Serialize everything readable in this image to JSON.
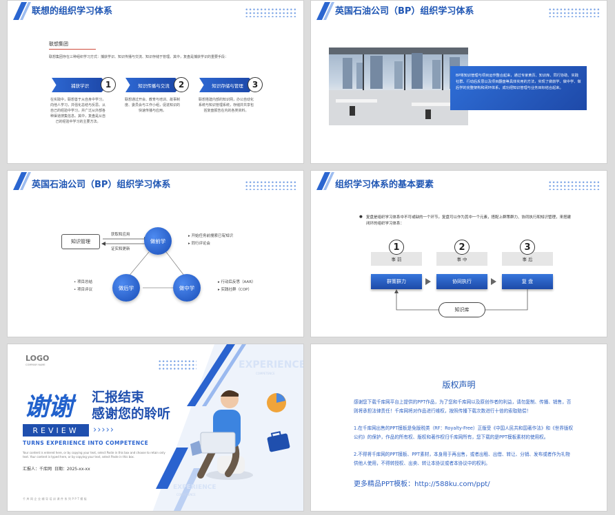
{
  "slide1": {
    "title": "联想的组织学习体系",
    "company": "联想集团",
    "intro": "联想集团存在三种组织学习方式：捕获学识、知识传播与交流、知识存储于管理。其中，复盘是捕获学识的重要手段：",
    "steps": [
      {
        "num": "1",
        "label": "捕获学识",
        "desc": "在实践中，联想善于从自身中学习，向他人学习，并强化总结与反思。从自己的经验中学习，并广泛从外部各种渠道搜集信息。其中，复盘是从自己的经验中学习的主要方法。"
      },
      {
        "num": "2",
        "label": "知识传播与交流",
        "desc": "联想通过开会、教育与培训、故事制度、委员会与工作小组，促进知识的快速传播与应用。"
      },
      {
        "num": "3",
        "label": "知识存储与管理",
        "desc": "联想搭建内部的知识网，办公自动化系统与知识管理系统，存储并共享包括复盘报告在内的各类资料。"
      }
    ]
  },
  "slide2": {
    "title": "英国石油公司（BP）组织学习体系",
    "box_text": "BP将知识管理与项目运作整合起来，通过专家黄页、知识库、同行协助、实践社群、行动后反思以及项目翻盘等具体实用的方法，实现了做前学、做中学、做后学的完整架构和闭环体系，成功把知识管理与业务目标结合起来。"
  },
  "slide3": {
    "title": "英国石油公司（BP）组织学习体系",
    "knowledge_box": "知识管理",
    "top_arrow_label": "获取和应用",
    "bottom_arrow_label": "证实和更新",
    "circles": {
      "before": "做前学",
      "after": "做后学",
      "during": "做中学"
    },
    "before_items": [
      "开始任务前搜索已有知识",
      "同行评论会"
    ],
    "after_items": [
      "项目总结",
      "项目评议"
    ],
    "during_items": [
      "行动后反思（AAR）",
      "实践社群（COP）"
    ]
  },
  "slide4": {
    "title": "组织学习体系的基本要素",
    "intro": "复盘是组织学习体系中不可或缺的一个环节。复盘可以作为其中一个元素，搭配上群策群力、协同执行和知识管理，来搭建闭环的组织学习体系：",
    "stages": [
      {
        "num": "1",
        "phase": "事 前",
        "action": "群策群力"
      },
      {
        "num": "2",
        "phase": "事 中",
        "action": "协同执行"
      },
      {
        "num": "3",
        "phase": "事 后",
        "action": "复 盘"
      }
    ],
    "loop_label": "知识库"
  },
  "slide5": {
    "logo": "LOGO",
    "logo_sub": "COMPANY NAME",
    "thanks": "谢谢",
    "line1": "汇报结束",
    "line2": "感谢您的聆听",
    "review": "REVIEW",
    "chevrons": "›››››",
    "tagline": "TURNS EXPERIENCE INTO COMPETENCE",
    "body": "Your content is entered here, or by copying your text, select Paste in this box and choose to retain only text. Your content is typed here, or by copying your text, select Paste in this box.",
    "reporter": "汇报人：千库网",
    "date": "日期：2025-xx-xx",
    "footer": "千库网企业辅导培训课件系列PPT模板",
    "watermark_top": "EXPERIENCE",
    "watermark_top_sub": "COMPETENCE",
    "watermark_bottom": "EXPERIENCE",
    "watermark_bottom_sub": "COMPETENCE"
  },
  "slide6": {
    "title": "版权声明",
    "p1": "感谢您下载千库网平台上提供的PPT作品，为了您和千库网以及原创作者的利益，请勿复制、传播、销售，否则将承担法律责任！千库网将对作品进行维权，按照传播下载次数进行十倍的索取赔偿！",
    "p2": "1.在千库网出售的PPT模板是免版税类（RF：Royalty-Free）正版受《中国人民共和国著作法》和《世界版权公约》的保护，作品的所有权、版权和著作权归千库网所有，您下载的是PPT模板素材的使用权。",
    "p3": "2.不得将千库网的PPT模板、PPT素材，本身用于再出售，或者出租、出借、转让、分销、发布或者作为礼物供他人使用，不得转授权、出卖、转让本协议或者本协议中的权利。",
    "more": "更多精品PPT模板：http://588ku.com/ppt/"
  }
}
